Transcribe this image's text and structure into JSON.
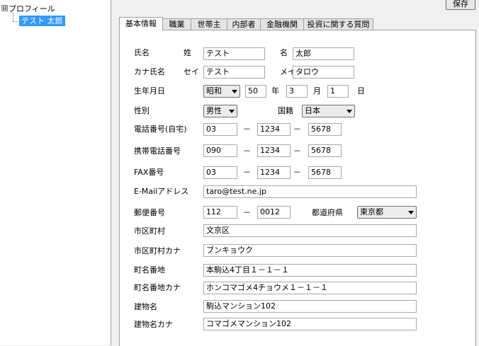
{
  "tree": {
    "root_label": "プロフィール",
    "toggle": "⊟",
    "child_label": "テスト 太郎"
  },
  "toolbar": {
    "save_label": "保存"
  },
  "tabs": [
    "基本情報",
    "職業",
    "世帯主",
    "内部者",
    "金融機関",
    "投資に関する質問"
  ],
  "form": {
    "name_label": "氏名",
    "last_name_label": "姓",
    "last_name": "テスト",
    "first_name_label": "名",
    "first_name": "太郎",
    "kana_label": "カナ氏名",
    "last_kana_label": "セイ",
    "last_kana": "テスト",
    "first_kana_label": "メイ",
    "first_kana": "タロウ",
    "birth_label": "生年月日",
    "era": "昭和",
    "birth_year": "50",
    "year_label": "年",
    "birth_month": "3",
    "month_label": "月",
    "birth_day": "1",
    "day_label": "日",
    "gender_label": "性別",
    "gender": "男性",
    "nationality_label": "国籍",
    "nationality": "日本",
    "home_phone_label": "電話番号(自宅)",
    "home_phone": [
      "03",
      "1234",
      "5678"
    ],
    "mobile_label": "携帯電話番号",
    "mobile": [
      "090",
      "1234",
      "5678"
    ],
    "fax_label": "FAX番号",
    "fax": [
      "03",
      "1234",
      "5678"
    ],
    "dash": "－",
    "email_label": "E-Mailアドレス",
    "email": "taro@test.ne.jp",
    "postal_label": "郵便番号",
    "postal": [
      "112",
      "0012"
    ],
    "prefecture_label": "都道府県",
    "prefecture": "東京都",
    "city_label": "市区町村",
    "city": "文京区",
    "city_kana_label": "市区町村カナ",
    "city_kana": "ブンキョウク",
    "address_label": "町名番地",
    "address": "本駒込4丁目１－１－１",
    "address_kana_label": "町名番地カナ",
    "address_kana": "ホンコマゴメ4チョウメ１－１－１",
    "building_label": "建物名",
    "building": "駒込マンション102",
    "building_kana_label": "建物名カナ",
    "building_kana": "コマゴメマンション102"
  }
}
